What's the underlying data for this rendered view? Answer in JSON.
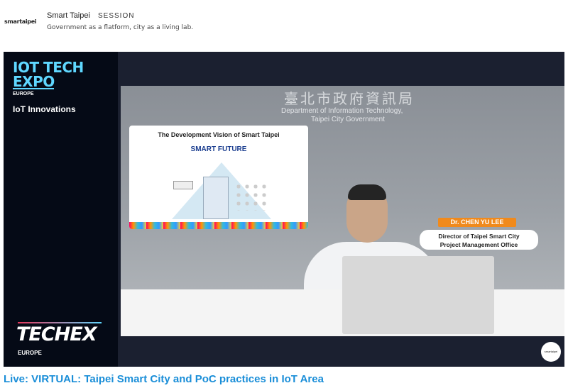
{
  "header": {
    "logo": "smartaipei",
    "org_name": "Smart Taipei",
    "session_label": "SESSION",
    "tagline": "Government as a flatform, city as a living lab."
  },
  "sidebar": {
    "expo_title": "IOT TECH EXPO",
    "expo_region": "EUROPE",
    "section": "IoT Innovations",
    "brand": "TECHEX",
    "brand_region": "EUROPE"
  },
  "video": {
    "wall_chinese": "臺北市政府資訊局",
    "wall_en_line1": "Department of Information Technology,",
    "wall_en_line2": "Taipei City Government",
    "slide_title": "The Development Vision of Smart Taipei",
    "slide_heading": "SMART FUTURE",
    "speaker_name": "Dr. CHEN YU LEE",
    "speaker_role_line1": "Director of Taipei Smart City",
    "speaker_role_line2": "Project Management Office",
    "badge": "smartaipei"
  },
  "title": "Live: VIRTUAL: Taipei Smart City and PoC practices in IoT Area",
  "colors": {
    "accent": "#1a8ed8",
    "expo_cyan": "#5fd7ff",
    "name_tag": "#f08a1c"
  }
}
